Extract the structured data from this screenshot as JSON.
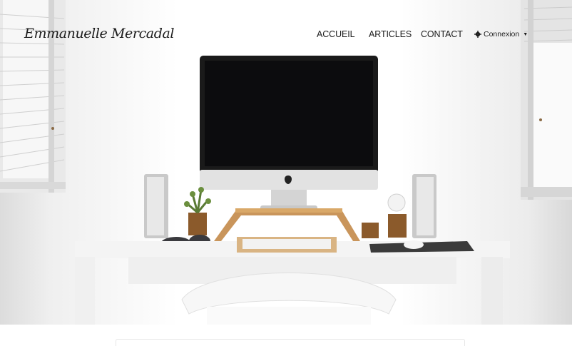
{
  "brand": {
    "name": "Emmanuelle Mercadal"
  },
  "nav": {
    "accueil": "ACCUEIL",
    "articles": "ARTICLES",
    "contact": "CONTACT",
    "login": "Connexion",
    "login_icon": "gear-icon",
    "login_caret": "caret-down-icon"
  },
  "hero": {
    "image": "desk-workspace-photo"
  },
  "colors": {
    "text": "#1b1b1b",
    "background": "#ffffff"
  }
}
